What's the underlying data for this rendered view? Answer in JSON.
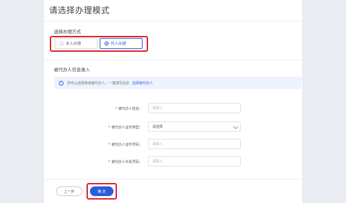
{
  "page": {
    "title": "请选择办理模式"
  },
  "mode": {
    "label": "选择办理方式",
    "options": [
      {
        "label": "本人办理",
        "selected": false
      },
      {
        "label": "代人办理",
        "selected": true
      }
    ]
  },
  "agent": {
    "section_title": "被代办人信息录入",
    "notice": {
      "text": "您可以选择常用被代办人，一键填写信息",
      "link": "选择被代办人"
    },
    "fields": [
      {
        "label": "被代办人姓名：",
        "placeholder": "请输入"
      },
      {
        "label": "被代办人证件类型：",
        "value": "请选择"
      },
      {
        "label": "被代办人证件号码：",
        "placeholder": "请输入"
      },
      {
        "label": "被代办人手机号码：",
        "placeholder": "请输入"
      }
    ]
  },
  "actions": {
    "prev_label": "上一步",
    "confirm_label": "确 定"
  },
  "colors": {
    "accent": "#2e5bd8",
    "highlight": "#e0222a"
  }
}
